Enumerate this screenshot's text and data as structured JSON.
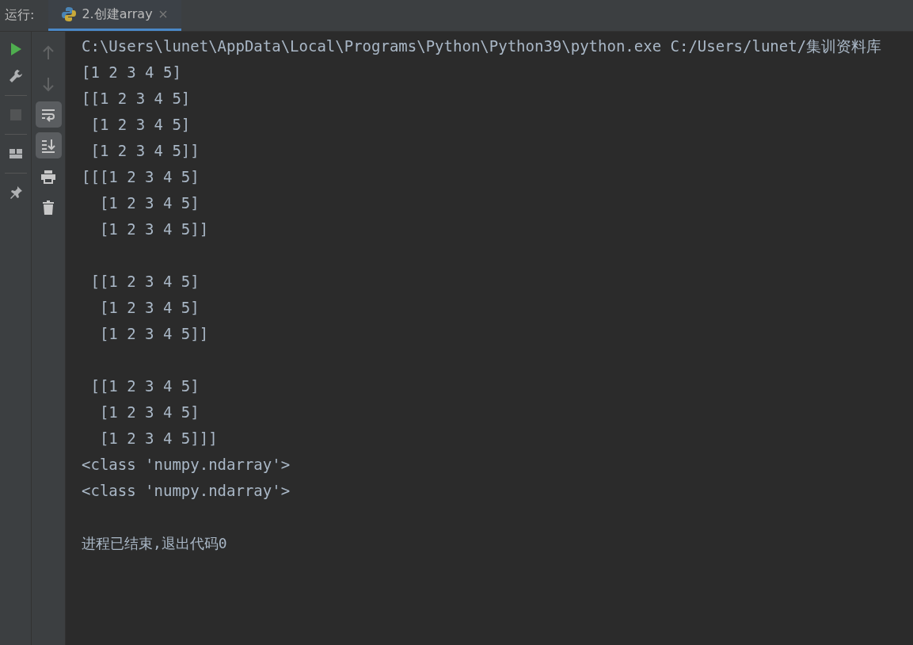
{
  "run_label": "运行:",
  "tabs": [
    {
      "label": "2.创建array",
      "selected": true
    }
  ],
  "left_toolbar": [
    {
      "kind": "run",
      "disabled": false
    },
    {
      "kind": "wrench",
      "disabled": false
    },
    {
      "kind": "stop",
      "disabled": true
    },
    {
      "kind": "layout",
      "disabled": false
    },
    {
      "kind": "pin",
      "disabled": false
    }
  ],
  "console_toolbar": [
    {
      "kind": "up",
      "disabled": true,
      "on": false
    },
    {
      "kind": "down",
      "disabled": true,
      "on": false
    },
    {
      "kind": "wrap",
      "disabled": false,
      "on": true
    },
    {
      "kind": "scroll-end",
      "disabled": false,
      "on": true
    },
    {
      "kind": "print",
      "disabled": false,
      "on": false
    },
    {
      "kind": "trash",
      "disabled": false,
      "on": false
    }
  ],
  "output_blocks": [
    [
      "C:\\Users\\lunet\\AppData\\Local\\Programs\\Python\\Python39\\python.exe C:/Users/lunet/集训资料库",
      "[1 2 3 4 5]",
      "[[1 2 3 4 5]",
      " [1 2 3 4 5]",
      " [1 2 3 4 5]]",
      "[[[1 2 3 4 5]",
      "  [1 2 3 4 5]",
      "  [1 2 3 4 5]]"
    ],
    [
      " [[1 2 3 4 5]",
      "  [1 2 3 4 5]",
      "  [1 2 3 4 5]]"
    ],
    [
      " [[1 2 3 4 5]",
      "  [1 2 3 4 5]",
      "  [1 2 3 4 5]]]",
      "<class 'numpy.ndarray'>",
      "<class 'numpy.ndarray'>"
    ],
    [
      "进程已结束,退出代码0"
    ]
  ]
}
